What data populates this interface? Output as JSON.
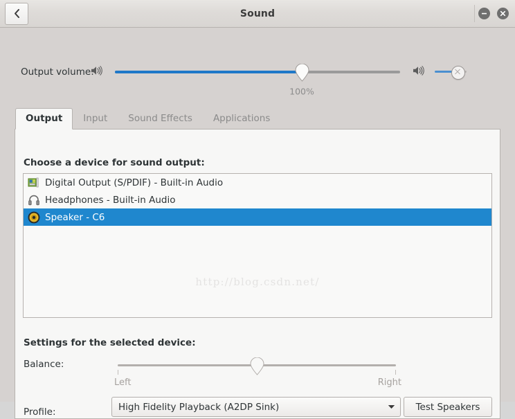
{
  "window": {
    "title": "Sound",
    "back_button": "back-chevron",
    "minimize_tooltip": "Minimize",
    "close_tooltip": "Close"
  },
  "volume": {
    "label": "Output volume:",
    "percent_text": "100%",
    "value": 100,
    "fill_ratio": 0.655,
    "amplify_value": 70,
    "speaker_icon": "volume-high-icon",
    "amplify_icon": "volume-high-icon"
  },
  "tabs": [
    {
      "label": "Output",
      "active": true
    },
    {
      "label": "Input",
      "active": false
    },
    {
      "label": "Sound Effects",
      "active": false
    },
    {
      "label": "Applications",
      "active": false
    }
  ],
  "output_page": {
    "choose_label": "Choose a device for sound output:",
    "devices": [
      {
        "label": "Digital Output (S/PDIF) - Built-in Audio",
        "icon": "digital-output-icon",
        "selected": false
      },
      {
        "label": "Headphones - Built-in Audio",
        "icon": "headphones-icon",
        "selected": false
      },
      {
        "label": "Speaker - C6",
        "icon": "speaker-icon",
        "selected": true
      }
    ],
    "watermark": "http://blog.csdn.net/",
    "settings_label": "Settings for the selected device:",
    "balance": {
      "label": "Balance:",
      "left_label": "Left",
      "right_label": "Right",
      "value": 0.5
    },
    "profile": {
      "label": "Profile:",
      "selected": "High Fidelity Playback (A2DP Sink)",
      "options": [
        "High Fidelity Playback (A2DP Sink)"
      ]
    },
    "test_speakers_label": "Test Speakers"
  },
  "colors": {
    "accent": "#1f87ce",
    "slider_fill": "#1f78c8",
    "window_bg": "#d6d2d0",
    "page_bg": "#f7f7f6",
    "text": "#2e3436",
    "muted_text": "#8b8b8b"
  }
}
